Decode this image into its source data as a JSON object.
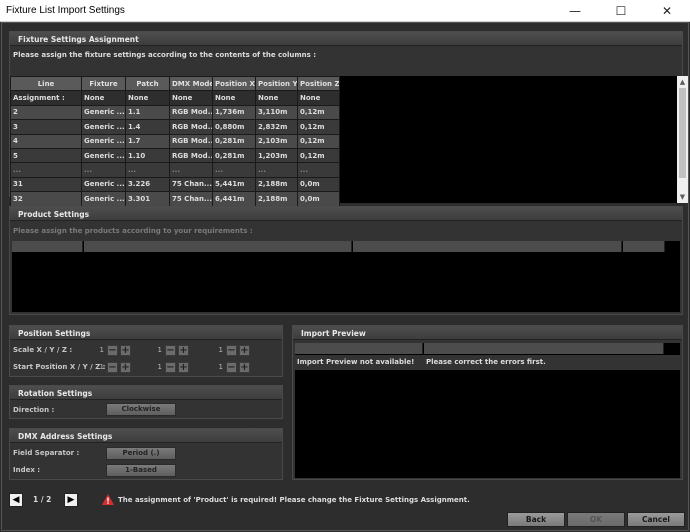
{
  "window": {
    "title": "Fixture List Import Settings",
    "minimize": "—",
    "maximize": "☐",
    "close": "✕"
  },
  "fixture_settings": {
    "title": "Fixture Settings Assignment",
    "hint": "Please assign the fixture settings according to the contents of the columns :",
    "columns": [
      "Line",
      "Fixture",
      "Patch",
      "DMX Mode",
      "Position X",
      "Position Y",
      "Position Z"
    ],
    "rows": [
      [
        "Assignment :",
        "None",
        "None",
        "None",
        "None",
        "None",
        "None"
      ],
      [
        "2",
        "Generic ...",
        "1.1",
        "RGB Mod...",
        "1,736m",
        "3,110m",
        "0,12m"
      ],
      [
        "3",
        "Generic ...",
        "1.4",
        "RGB Mod...",
        "0,880m",
        "2,832m",
        "0,12m"
      ],
      [
        "4",
        "Generic ...",
        "1.7",
        "RGB Mod...",
        "0,281m",
        "2,103m",
        "0,12m"
      ],
      [
        "5",
        "Generic ...",
        "1.10",
        "RGB Mod...",
        "0,281m",
        "1,203m",
        "0,12m"
      ],
      [
        "...",
        "...",
        "...",
        "...",
        "...",
        "...",
        "..."
      ],
      [
        "31",
        "Generic ...",
        "3.226",
        "75 Chan...",
        "5,441m",
        "2,188m",
        "0,0m"
      ],
      [
        "32",
        "Generic ...",
        "3.301",
        "75 Chan...",
        "6,441m",
        "2,188m",
        "0,0m"
      ]
    ],
    "scroll_up": "▲",
    "scroll_down": "▼"
  },
  "product_settings": {
    "title": "Product Settings",
    "hint": "Please assign the products according to your requirements :"
  },
  "position_settings": {
    "title": "Position Settings",
    "scale_label": "Scale X / Y / Z :",
    "start_label": "Start Position X / Y / Z :",
    "scale_values": [
      "1",
      "1",
      "1"
    ],
    "start_values": [
      "1",
      "1",
      "1"
    ],
    "minus": "−",
    "plus": "+"
  },
  "rotation_settings": {
    "title": "Rotation Settings",
    "direction_label": "Direction :",
    "direction_value": "Clockwise"
  },
  "dmx_settings": {
    "title": "DMX Address Settings",
    "separator_label": "Field Separator :",
    "separator_value": "Period (.)",
    "index_label": "Index :",
    "index_value": "1-Based"
  },
  "import_preview": {
    "title": "Import Preview",
    "message_left": "Import Preview not available!",
    "message_right": "Please correct the errors first."
  },
  "footer": {
    "page": "1 / 2",
    "prev": "◀",
    "next": "▶",
    "warning_icon": "warning-icon",
    "warning": "The assignment of 'Product' is required! Please change the Fixture Settings Assignment.",
    "back": "Back",
    "ok": "OK",
    "cancel": "Cancel"
  },
  "colors": {
    "background": "#2d2d2d",
    "panel_header": "#4e4e4e",
    "warning": "#d32f2f"
  }
}
